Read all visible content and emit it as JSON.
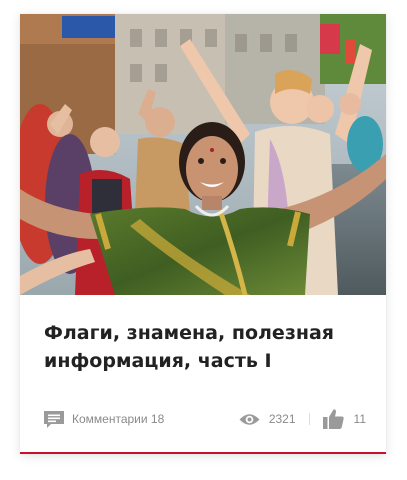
{
  "card": {
    "image_alt": "photo-festival-crowd",
    "title": "Флаги, знамена, полезная информация, часть I",
    "comments_label": "Комментарии 18",
    "views": "2321",
    "likes": "11"
  },
  "icons": {
    "comments": "comment-icon",
    "views": "eye-icon",
    "likes": "thumbs-up-icon"
  },
  "colors": {
    "accent": "#c8102e",
    "icon": "#9a9a9a",
    "title": "#222222",
    "meta": "#8a8a8a"
  }
}
